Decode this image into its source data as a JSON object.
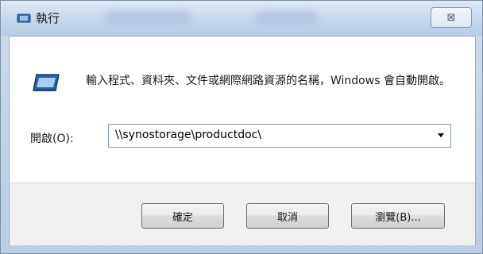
{
  "window": {
    "title": "執行",
    "close_glyph": "⊠"
  },
  "dialog": {
    "description": "輸入程式、資料夾、文件或網際網路資源的名稱，Windows 會自動開啟。",
    "open_label": "開啟(O):",
    "open_value": "\\\\synostorage\\productdoc\\"
  },
  "buttons": {
    "ok": "確定",
    "cancel": "取消",
    "browse": "瀏覽(B)..."
  },
  "icons": {
    "title": "run-icon",
    "dialog": "run-icon",
    "dropdown": "chevron-down-icon"
  }
}
